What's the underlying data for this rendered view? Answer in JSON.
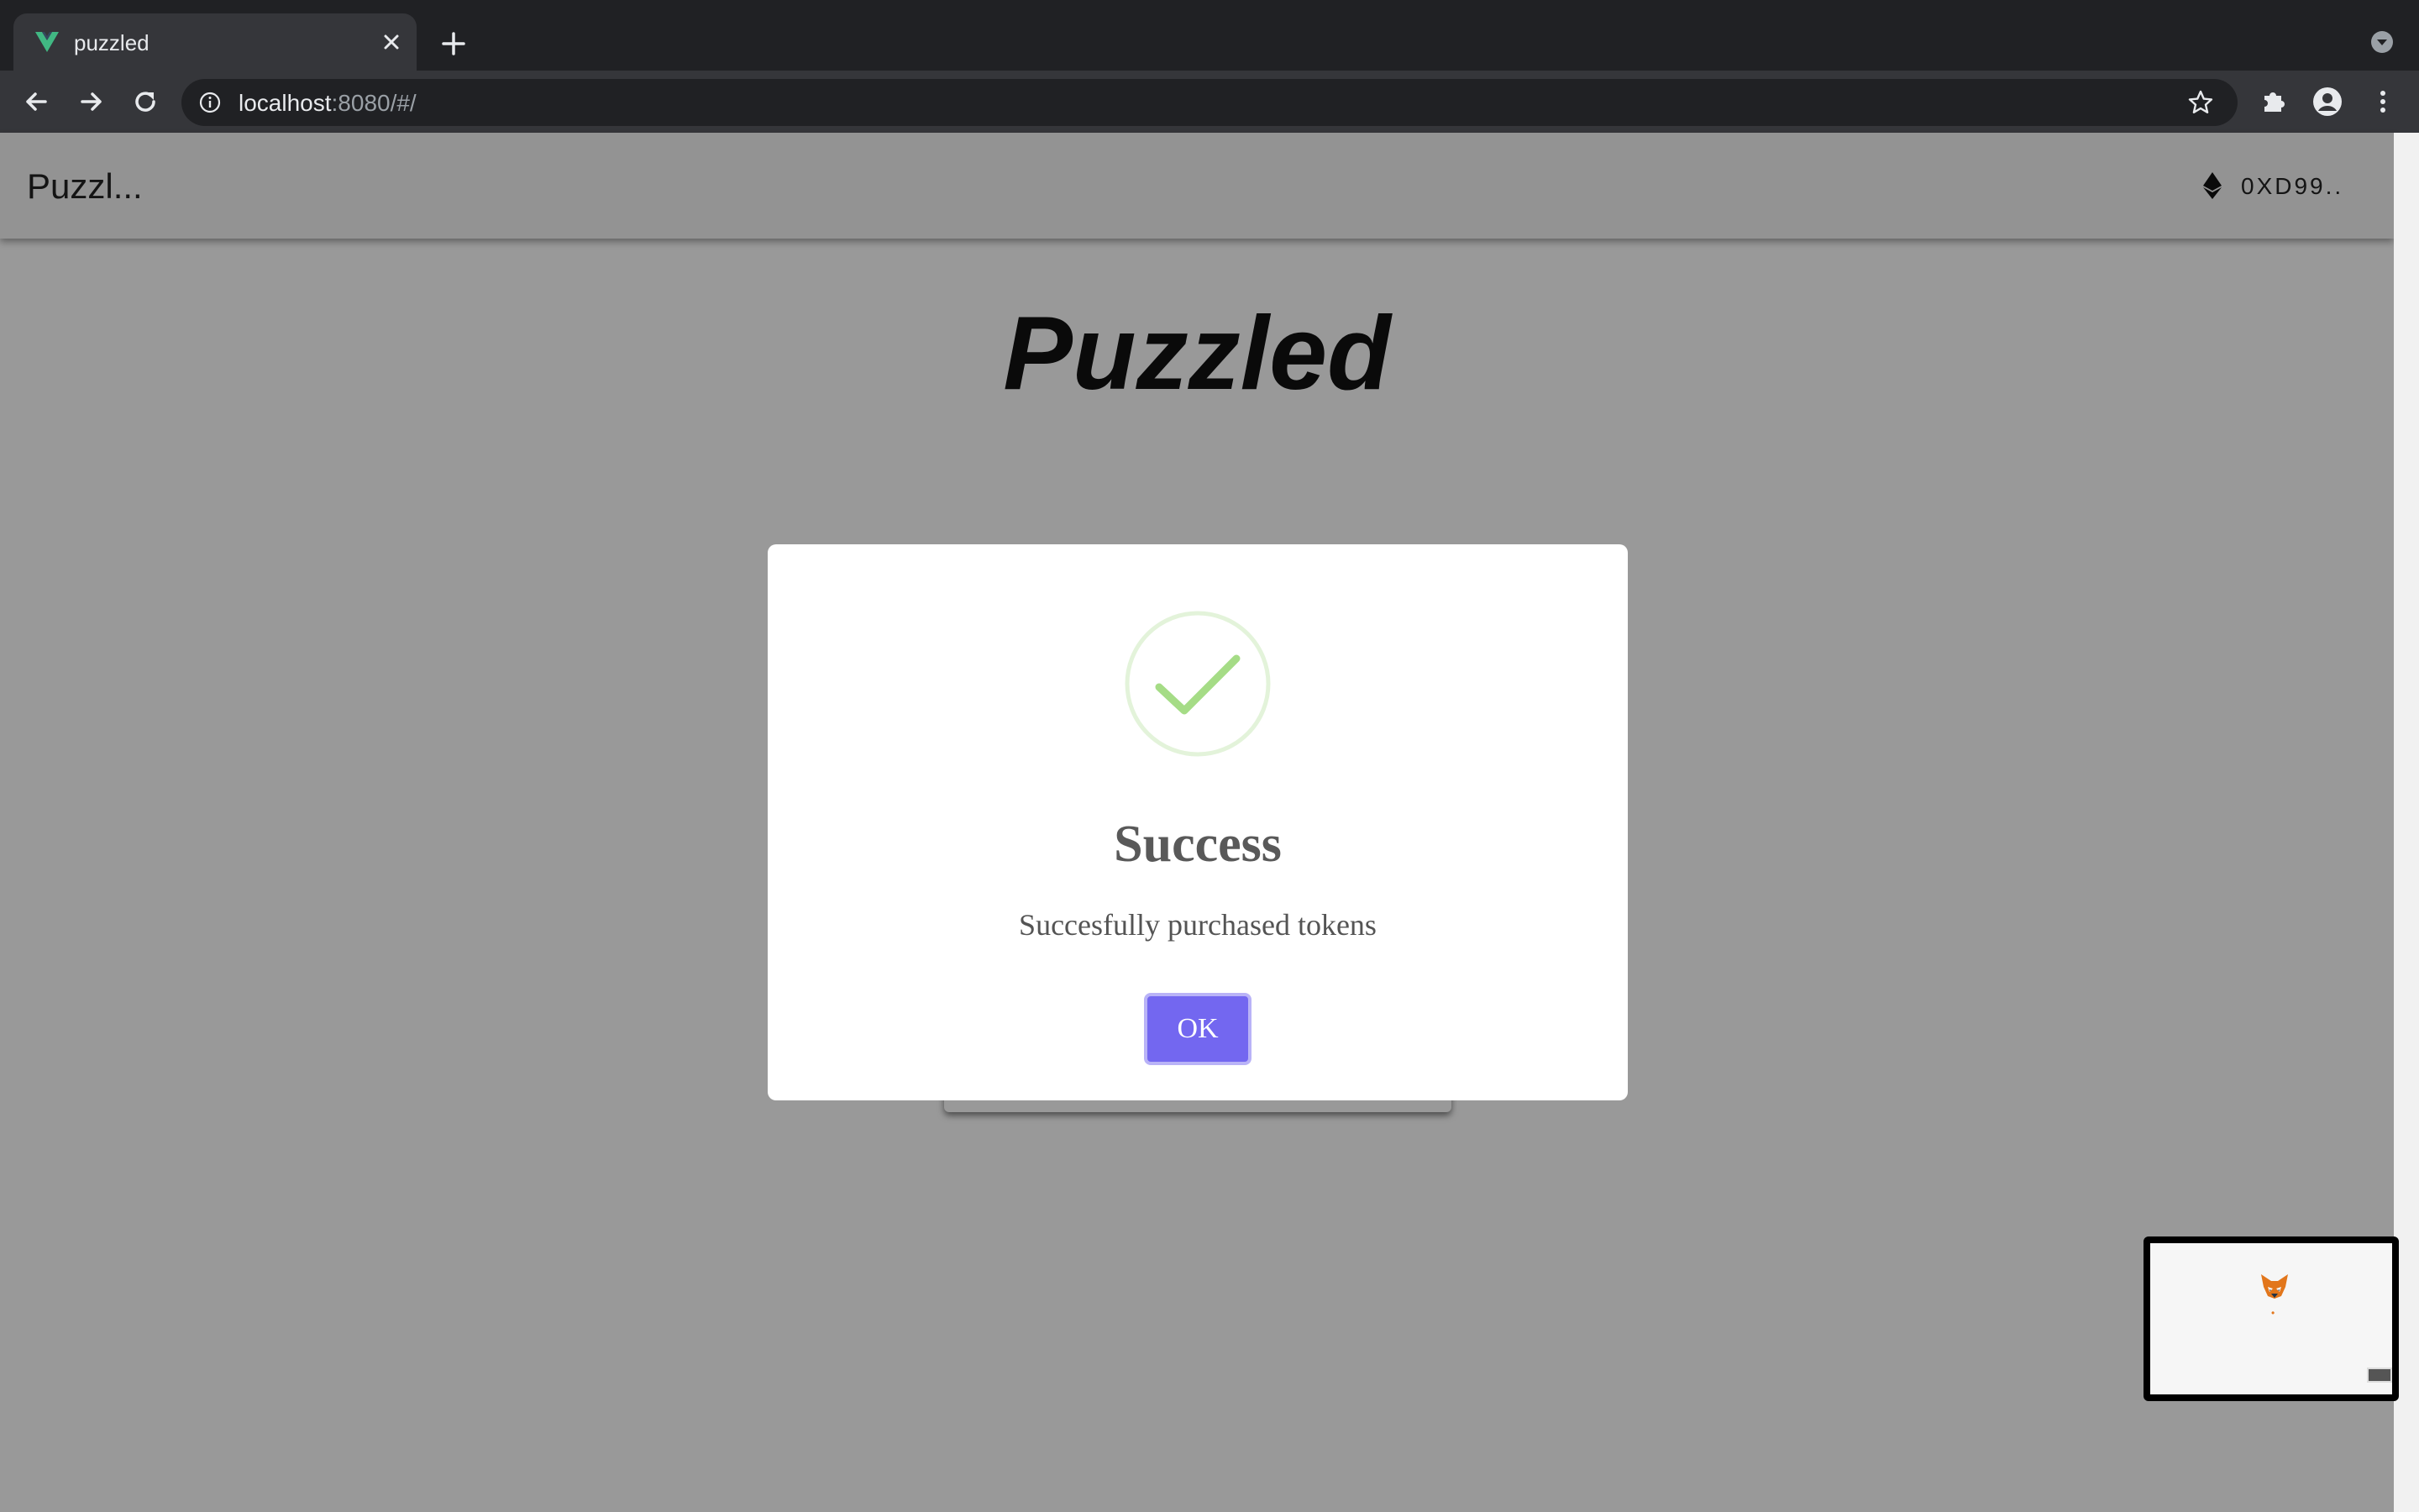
{
  "browser": {
    "tab": {
      "title": "puzzled"
    },
    "url": {
      "host": "localhost",
      "rest": ":8080/#/"
    }
  },
  "app": {
    "brand": "Puzzl...",
    "account": "0XD99..",
    "hero_title": "Puzzled"
  },
  "modal": {
    "title": "Success",
    "message": "Succesfully purchased tokens",
    "ok_label": "OK"
  },
  "colors": {
    "accent": "#7367f0",
    "success": "#a5dc86",
    "vue_green": "#41b883"
  },
  "icons": {
    "tab_favicon": "vue-logo-icon",
    "metamask": "metamask-fox-icon",
    "network": "ethereum-icon"
  }
}
